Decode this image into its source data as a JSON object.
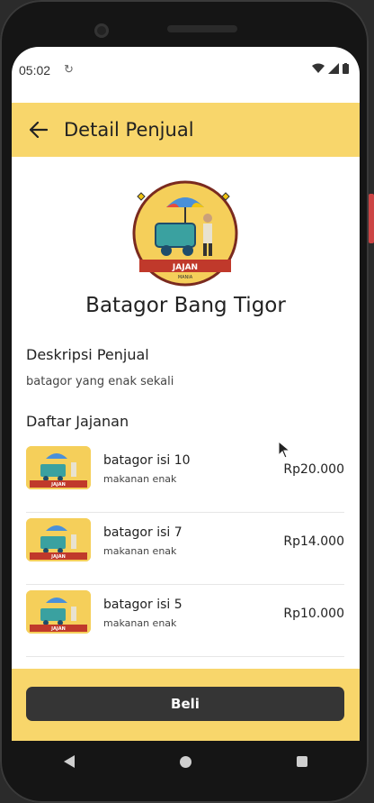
{
  "status": {
    "time": "05:02",
    "sync_icon": "sync-icon",
    "wifi_icon": "wifi-icon",
    "signal_icon": "signal-icon",
    "battery_icon": "battery-icon"
  },
  "header": {
    "back_icon": "arrow-back-icon",
    "title": "Detail Penjual"
  },
  "seller": {
    "logo_text_1": "JAJAN",
    "logo_text_2": "MANIA",
    "name": "Batagor Bang Tigor",
    "description_title": "Deskripsi Penjual",
    "description": "batagor yang enak sekali"
  },
  "snacks": {
    "title": "Daftar Jajanan",
    "items": [
      {
        "name": "batagor isi 10",
        "desc": "makanan enak",
        "price": "Rp20.000"
      },
      {
        "name": "batagor isi 7",
        "desc": "makanan enak",
        "price": "Rp14.000"
      },
      {
        "name": "batagor isi 5",
        "desc": "makanan enak",
        "price": "Rp10.000"
      }
    ]
  },
  "footer": {
    "buy_label": "Beli"
  },
  "colors": {
    "accent": "#f8d66b",
    "button": "#353535"
  }
}
